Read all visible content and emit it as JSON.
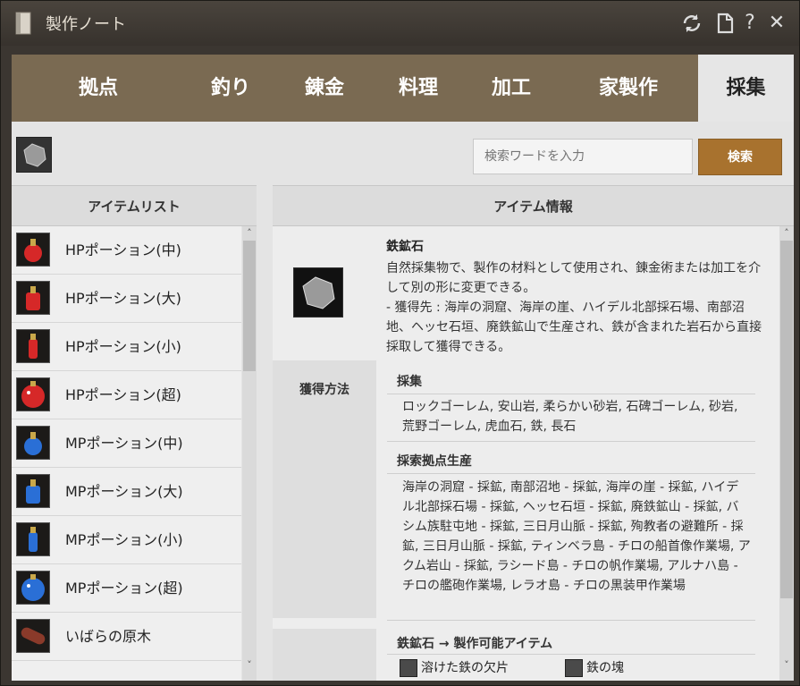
{
  "window": {
    "title": "製作ノート"
  },
  "tabs": [
    {
      "label": "拠点"
    },
    {
      "label": "釣り"
    },
    {
      "label": "錬金"
    },
    {
      "label": "料理"
    },
    {
      "label": "加工"
    },
    {
      "label": "家製作"
    },
    {
      "label": "採集",
      "active": true
    }
  ],
  "search": {
    "placeholder": "検索ワードを入力",
    "button_label": "検索"
  },
  "item_list": {
    "header": "アイテムリスト",
    "items": [
      {
        "label": "HPポーション(中)",
        "icon": "red-potion-icon"
      },
      {
        "label": "HPポーション(大)",
        "icon": "red-potion-icon"
      },
      {
        "label": "HPポーション(小)",
        "icon": "red-potion-icon"
      },
      {
        "label": "HPポーション(超)",
        "icon": "red-potion-icon"
      },
      {
        "label": "MPポーション(中)",
        "icon": "blue-potion-icon"
      },
      {
        "label": "MPポーション(大)",
        "icon": "blue-potion-icon"
      },
      {
        "label": "MPポーション(小)",
        "icon": "blue-potion-icon"
      },
      {
        "label": "MPポーション(超)",
        "icon": "blue-potion-icon"
      },
      {
        "label": "いばらの原木",
        "icon": "log-icon"
      }
    ]
  },
  "item_info": {
    "header": "アイテム情報",
    "name": "鉄鉱石",
    "description": "自然採集物で、製作の材料として使用され、錬金術または加工を介して別の形に変更できる。\n- 獲得先 : 海岸の洞窟、海岸の崖、ハイデル北部採石場、南部沼地、ヘッセ石垣、廃鉄鉱山で生産され、鉄が含まれた岩石から直接採取して獲得できる。",
    "acquisition_label": "獲得方法",
    "sections": [
      {
        "title": "採集",
        "body": "ロックゴーレム, 安山岩, 柔らかい砂岩, 石碑ゴーレム, 砂岩, 荒野ゴーレム, 虎血石, 鉄, 長石"
      },
      {
        "title": "採索拠点生産",
        "body": "海岸の洞窟 - 採鉱, 南部沼地 - 採鉱, 海岸の崖 - 採鉱, ハイデル北部採石場 - 採鉱, ヘッセ石垣 - 採鉱, 廃鉄鉱山 - 採鉱, バシム族駐屯地 - 採鉱, 三日月山脈 - 採鉱, 殉教者の避難所 - 採鉱, 三日月山脈 - 採鉱, ティンベラ島 - チロの船首像作業場, アクム岩山 - 採鉱, ラシード島 - チロの帆作業場, アルナハ島 - チロの艦砲作業場, レラオ島 - チロの黒装甲作業場"
      }
    ],
    "craftable_title": "鉄鉱石 → 製作可能アイテム",
    "craftable": [
      {
        "label": "溶けた鉄の欠片",
        "icon": "iron-shard-icon"
      },
      {
        "label": "鉄の塊",
        "icon": "iron-ingot-icon"
      }
    ]
  }
}
